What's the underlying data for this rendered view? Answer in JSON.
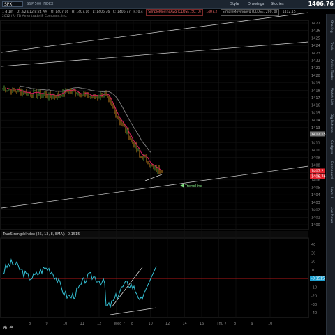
{
  "toolbar": {
    "symbol": "SPX",
    "timeframe": "1 d  1m",
    "description": "S&P 500 INDEX",
    "buttons": [
      {
        "label": "Style"
      },
      {
        "label": "Drawings"
      },
      {
        "label": "Studies"
      }
    ],
    "last_price": "1406.76"
  },
  "infobar": {
    "date": "D: 3/28/12 8:24 AM",
    "open": "O: 1407.16",
    "high": "H: 1407.16",
    "low": "L: 1406.76",
    "close": "C: 1406.77",
    "range": "R: 0.4",
    "sma1": "SimpleMovingAvg (CLOSE, 50, 0)",
    "sma1_val": "1407.2",
    "sma2": "SimpleMovingAvg (CLOSE, 200, 0)",
    "sma2_val": "1412.15",
    "copyright": "2012 (R) TD Ameritrade IP Company, Inc."
  },
  "price_axis": {
    "ticks": [
      "1427",
      "1426",
      "1425",
      "1424",
      "1423",
      "1422",
      "1421",
      "1420",
      "1419",
      "1418",
      "1417",
      "1416",
      "1415",
      "1414",
      "1413",
      "1412",
      "1411",
      "1410",
      "1409",
      "1408",
      "1407",
      "1406",
      "1405",
      "1404",
      "1403",
      "1402",
      "1401",
      "1400"
    ],
    "badges": [
      {
        "value": "1412.15",
        "color": "#777777"
      },
      {
        "value": "1407.2",
        "color": "#e0212b"
      },
      {
        "value": "1406.76",
        "color": "#e0212b"
      }
    ]
  },
  "lower_study": {
    "title": "TrueStrengthIndex (25, 13, 8, EMA): -0.1515",
    "ticks": [
      "40",
      "30",
      "20",
      "10",
      "0",
      "-10",
      "-20",
      "-30",
      "-40"
    ],
    "badge": {
      "value": "-0.1515",
      "color": "#1ea0d0"
    }
  },
  "time_axis": {
    "ticks": [
      "8",
      "9",
      "10",
      "11",
      "12",
      "Wed 7",
      "8",
      "10",
      "12",
      "14",
      "16",
      "Thu 7",
      "8",
      "9",
      "10"
    ]
  },
  "annotations": {
    "trendline": "Trendline"
  },
  "sidebar": {
    "items": [
      "Sharing",
      "Trade",
      "Active Trader",
      "Watch-List",
      "Big Buttons",
      "Gadgets",
      "Dashboard",
      "Level II",
      "Live News"
    ]
  },
  "colors": {
    "background": "#000000",
    "candle_up": "#5aa33a",
    "candle_down": "#d89020",
    "sma_fast": "#d81b60",
    "sma_slow": "#7a7a7a",
    "tsi_line": "#35c4d8",
    "zero_line": "#b01818",
    "trendline": "#d8d8d8"
  }
}
